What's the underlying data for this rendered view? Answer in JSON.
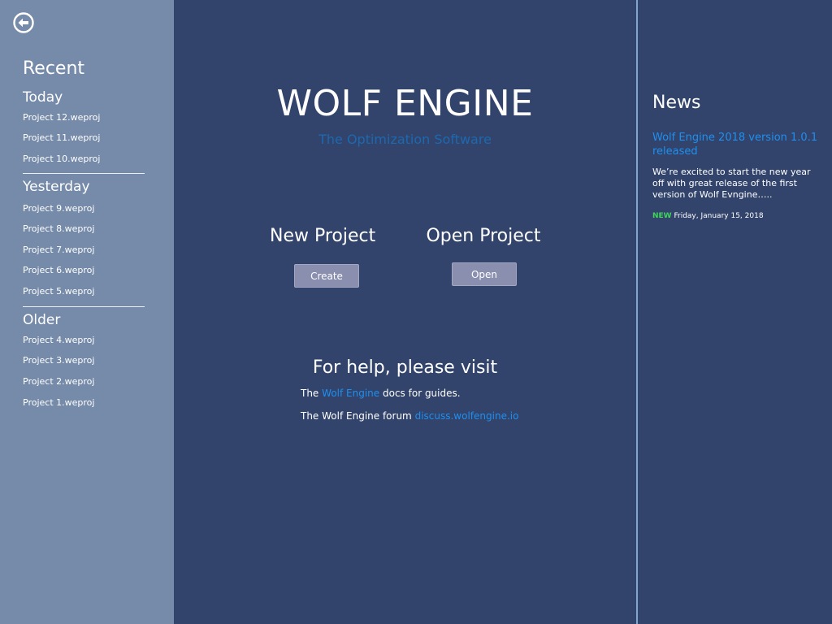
{
  "sidebar": {
    "back_icon": "arrow-left-circle-icon",
    "title": "Recent",
    "groups": [
      {
        "label": "Today",
        "items": [
          "Project 12.weproj",
          "Project 11.weproj",
          "Project 10.weproj"
        ]
      },
      {
        "label": "Yesterday",
        "items": [
          "Project 9.weproj",
          "Project 8.weproj",
          "Project 7.weproj",
          "Project 6.weproj",
          "Project 5.weproj"
        ]
      },
      {
        "label": "Older",
        "items": [
          "Project 4.weproj",
          "Project 3.weproj",
          "Project 2.weproj",
          "Project 1.weproj"
        ]
      }
    ]
  },
  "main": {
    "title": "WOLF ENGINE",
    "subtitle": "The Optimization Software",
    "new_project": {
      "title": "New Project",
      "button": "Create"
    },
    "open_project": {
      "title": "Open Project",
      "button": "Open"
    },
    "help": {
      "title": "For help, please visit",
      "line1_prefix": "The",
      "line1_link": "Wolf Engine",
      "line1_suffix": "docs for guides.",
      "line2_prefix": "The Wolf Engine forum",
      "line2_link": "discuss.wolfengine.io"
    }
  },
  "news": {
    "title": "News",
    "headline": "Wolf Engine 2018 version 1.0.1 released",
    "body": "We’re excited to start the new year off with great release of  the first version of Wolf Evngine…..",
    "badge": "NEW",
    "date": "Friday, January 15, 2018"
  },
  "colors": {
    "background": "#32446b",
    "sidebar": "#768ba9",
    "link": "#1e8ff0",
    "subtitle": "#1d68b0",
    "button": "#8a8fb0",
    "badge": "#3dd659",
    "divider": "#7ea6cf"
  }
}
